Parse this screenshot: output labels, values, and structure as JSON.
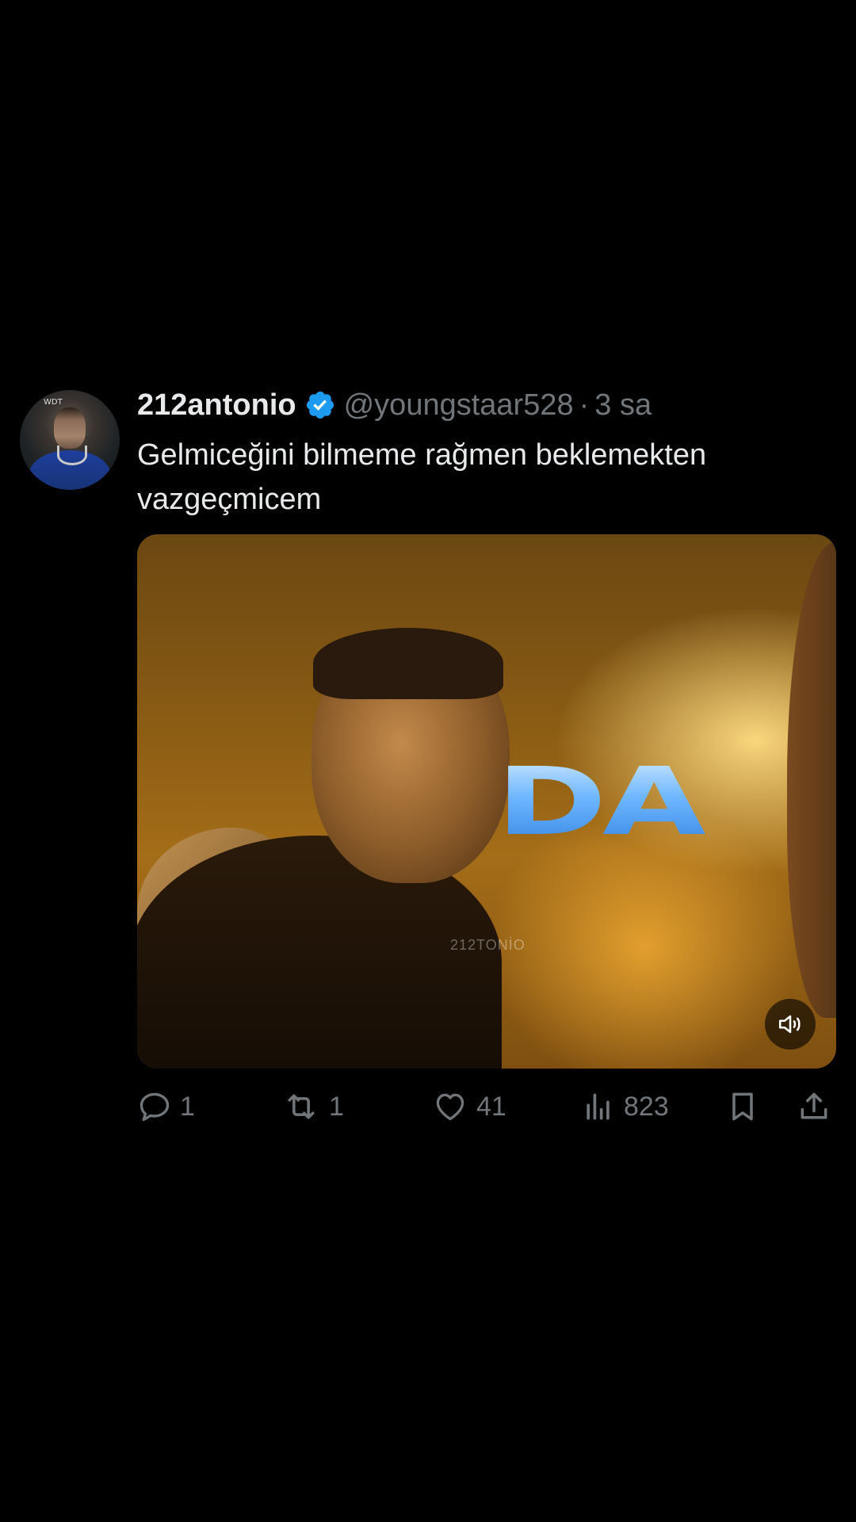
{
  "tweet": {
    "display_name": "212antonio",
    "handle": "@youngstaar528",
    "separator": "·",
    "time": "3 sa",
    "text": "Gelmiceğini bilmeme rağmen beklemekten vazgeçmicem",
    "verified": true,
    "verified_color": "#1d9bf0"
  },
  "media": {
    "overlay_text": "DA",
    "overlay_color": "#4aa3ff",
    "watermark": "212TONİO",
    "muted": true
  },
  "actions": {
    "replies": "1",
    "retweets": "1",
    "likes": "41",
    "views": "823"
  },
  "colors": {
    "background": "#000000",
    "text": "#e7e9ea",
    "secondary": "#71767b"
  }
}
